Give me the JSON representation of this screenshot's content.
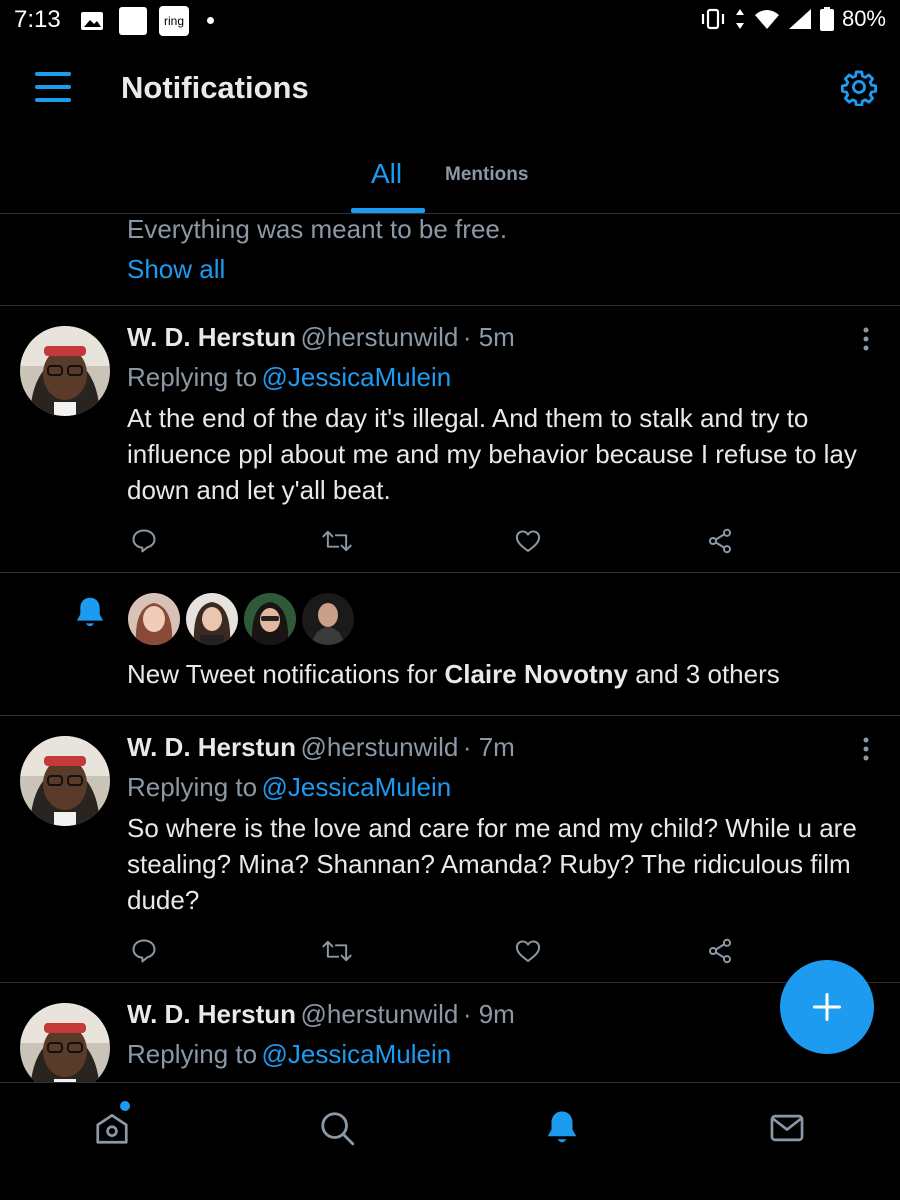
{
  "status_bar": {
    "time": "7:13",
    "ring_label": "ring",
    "network": "5",
    "battery": "80%"
  },
  "header": {
    "title": "Notifications",
    "menu_icon": "hamburger-menu-icon",
    "settings_icon": "gear-icon"
  },
  "tabs": [
    {
      "label": "All",
      "active": true
    },
    {
      "label": "Mentions",
      "active": false
    }
  ],
  "truncated": {
    "text": "Everything was meant to be free.",
    "show_all": "Show all"
  },
  "tweets": [
    {
      "name": "W. D. Herstun",
      "handle": "@herstunwild",
      "time": "· 5m",
      "replying_prefix": "Replying to",
      "replying_to": "@JessicaMulein",
      "text": "At the end of the day it's illegal. And them to stalk and try to influence ppl about me and my behavior because I refuse to lay down and let y'all beat."
    },
    {
      "name": "W. D. Herstun",
      "handle": "@herstunwild",
      "time": "· 7m",
      "replying_prefix": "Replying to",
      "replying_to": "@JessicaMulein",
      "text": "So where is the love and care for me and my child? While u are stealing? Mina? Shannan? Amanda? Ruby? The ridiculous film dude?"
    },
    {
      "name": "W. D. Herstun",
      "handle": "@herstunwild",
      "time": "· 9m",
      "replying_prefix": "Replying to",
      "replying_to": "@JessicaMulein"
    }
  ],
  "notification": {
    "prefix": "New Tweet notifications for",
    "bold_name": "Claire Novotny",
    "suffix": "and 3 others"
  },
  "colors": {
    "accent": "#1d9bf0",
    "background": "#000000",
    "text": "#e7e9ea",
    "muted": "#8b98a5"
  },
  "bottom_nav": [
    "home-icon",
    "search-icon",
    "notifications-bell-icon",
    "messages-mail-icon"
  ]
}
